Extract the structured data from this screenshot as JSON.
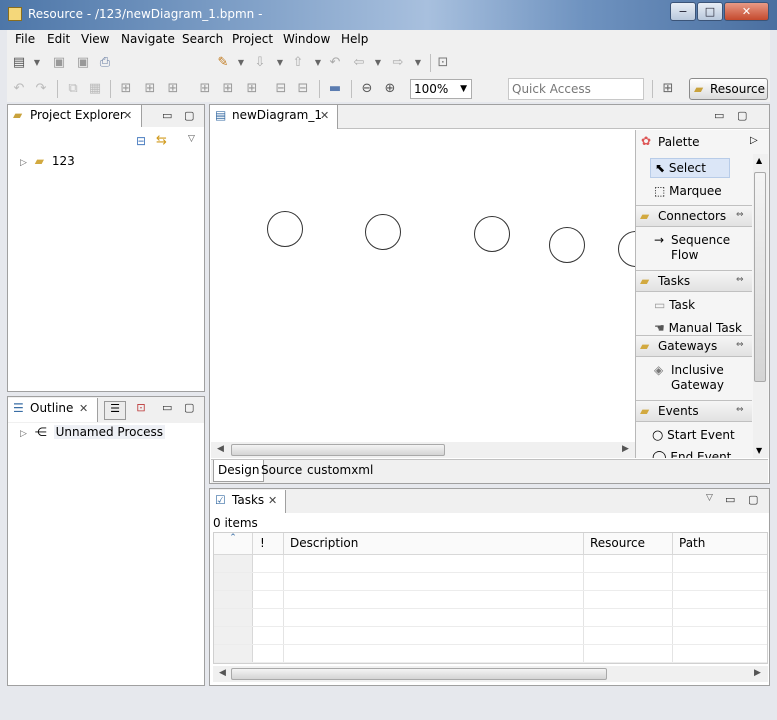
{
  "window": {
    "title": "Resource - /123/newDiagram_1.bpmn -",
    "min": "−",
    "max": "□",
    "close": "✕"
  },
  "menu": [
    "File",
    "Edit",
    "View",
    "Navigate",
    "Search",
    "Project",
    "Window",
    "Help"
  ],
  "toolbar": {
    "zoom": "100%",
    "quick_access_placeholder": "Quick Access",
    "perspective": "Resource"
  },
  "project_explorer": {
    "title": "Project Explorer",
    "tree": [
      {
        "label": "123"
      }
    ]
  },
  "outline": {
    "title": "Outline",
    "tree": [
      {
        "label": "Unnamed Process"
      }
    ]
  },
  "editor": {
    "tab": "newDiagram_1",
    "bottom_tabs": [
      "Design",
      "Source",
      "customxml"
    ],
    "palette": {
      "title": "Palette",
      "tools": [
        "Select",
        "Marquee"
      ],
      "groups": [
        {
          "name": "Connectors",
          "items": [
            "Sequence Flow"
          ]
        },
        {
          "name": "Tasks",
          "items": [
            "Task",
            "Manual Task"
          ]
        },
        {
          "name": "Gateways",
          "items": [
            "Inclusive Gateway"
          ]
        },
        {
          "name": "Events",
          "items": [
            "Start Event",
            "End Event"
          ]
        }
      ]
    }
  },
  "tasks": {
    "title": "Tasks",
    "count": "0 items",
    "columns": [
      "!",
      "Description",
      "Resource",
      "Path"
    ]
  }
}
